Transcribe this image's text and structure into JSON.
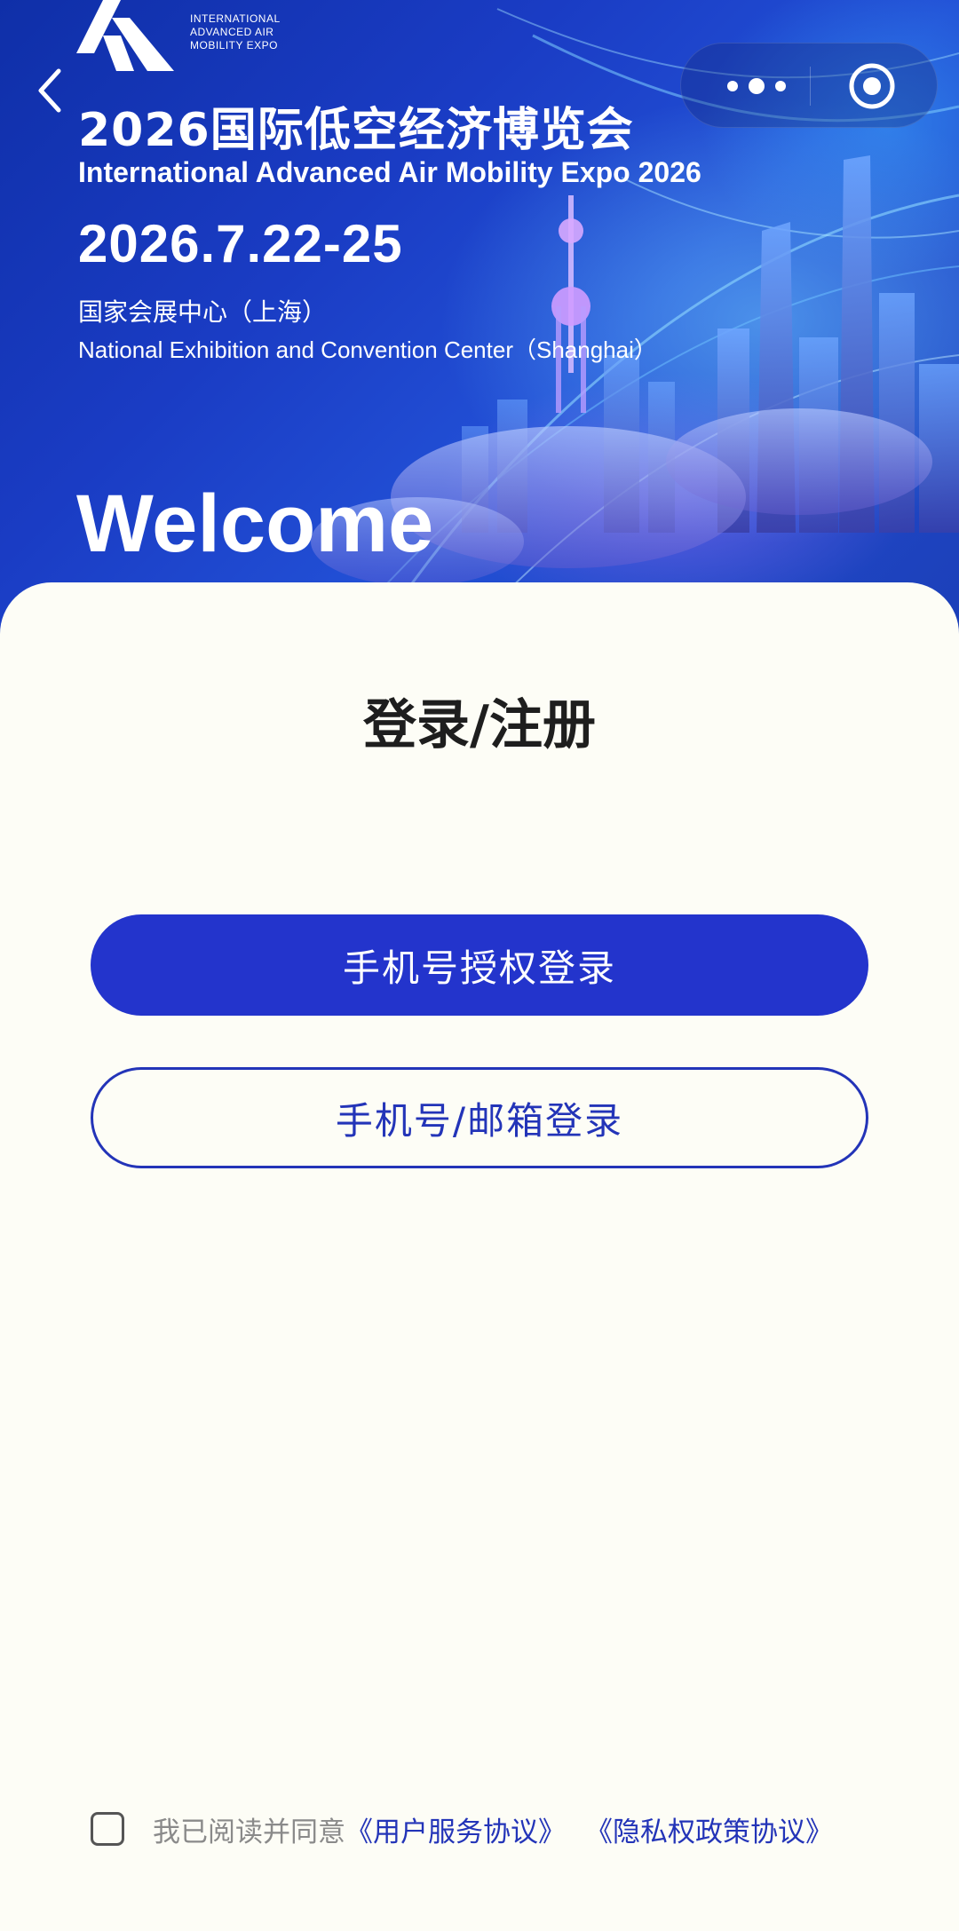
{
  "colors": {
    "hero_start": "#0f2fa8",
    "hero_end": "#2250d6",
    "sheet_background": "#fdfdf6",
    "primary_button": "#2334cc",
    "outline_button": "#2334b8",
    "link": "#2334b8"
  },
  "header": {
    "logo_text": [
      "INTERNATIONAL",
      "ADVANCED AIR",
      "MOBILITY EXPO"
    ],
    "back_icon": "chevron-left-icon",
    "menu_icon": "more-dots-icon",
    "close_icon": "target-circle-icon"
  },
  "hero": {
    "title": "2026国际低空经济博览会",
    "subtitle": "International Advanced Air Mobility Expo 2026",
    "date": "2026.7.22-25",
    "venue_cn": "国家会展中心（上海）",
    "venue_en": "National Exhibition and Convention Center（Shanghai）",
    "welcome": "Welcome"
  },
  "login": {
    "title": "登录/注册",
    "primary_button": "手机号授权登录",
    "secondary_button": "手机号/邮箱登录"
  },
  "agreement": {
    "checked": false,
    "prefix": "我已阅读并同意",
    "user_agreement": "《用户服务协议》",
    "privacy_policy": "《隐私权政策协议》"
  }
}
